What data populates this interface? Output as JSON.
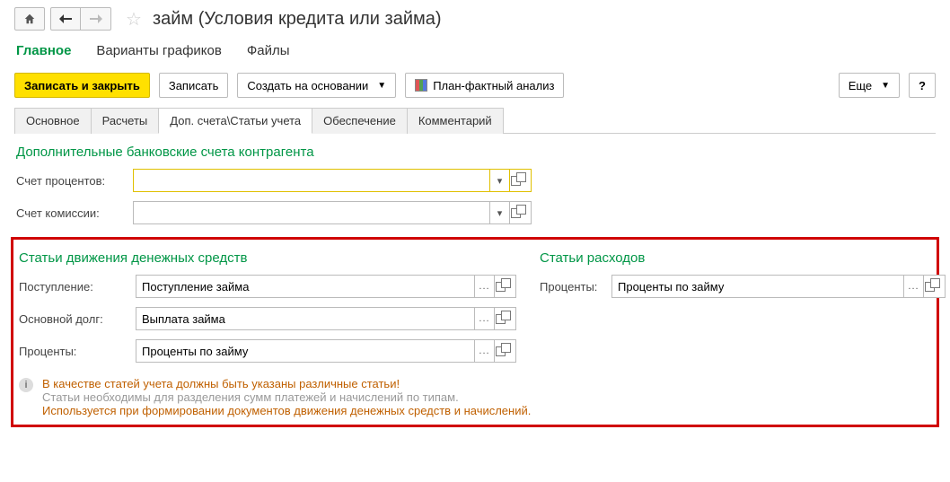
{
  "header": {
    "title": "займ (Условия кредита или займа)"
  },
  "menu": {
    "items": [
      {
        "label": "Главное",
        "active": true
      },
      {
        "label": "Варианты графиков",
        "active": false
      },
      {
        "label": "Файлы",
        "active": false
      }
    ]
  },
  "toolbar": {
    "save_close": "Записать и закрыть",
    "save": "Записать",
    "create_based": "Создать на основании",
    "plan_fact": "План-фактный анализ",
    "more": "Еще",
    "help": "?"
  },
  "tabs": [
    {
      "label": "Основное",
      "active": false
    },
    {
      "label": "Расчеты",
      "active": false
    },
    {
      "label": "Доп. счета\\Статьи учета",
      "active": true
    },
    {
      "label": "Обеспечение",
      "active": false
    },
    {
      "label": "Комментарий",
      "active": false
    }
  ],
  "sections": {
    "bank_accounts": {
      "title": "Дополнительные банковские счета контрагента",
      "interest_label": "Счет процентов:",
      "interest_value": "",
      "commission_label": "Счет комиссии:",
      "commission_value": ""
    },
    "cashflow": {
      "title": "Статьи движения денежных средств",
      "receipt_label": "Поступление:",
      "receipt_value": "Поступление займа",
      "principal_label": "Основной долг:",
      "principal_value": "Выплата займа",
      "interest_label": "Проценты:",
      "interest_value": "Проценты по займу"
    },
    "expenses": {
      "title": "Статьи расходов",
      "interest_label": "Проценты:",
      "interest_value": "Проценты по займу"
    }
  },
  "info": {
    "warning": "В качестве статей учета должны быть указаны различные статьи!",
    "line2": "Статьи необходимы для разделения сумм платежей и начислений по типам.",
    "line3": "Используется при формировании документов движения денежных средств и начислений."
  }
}
